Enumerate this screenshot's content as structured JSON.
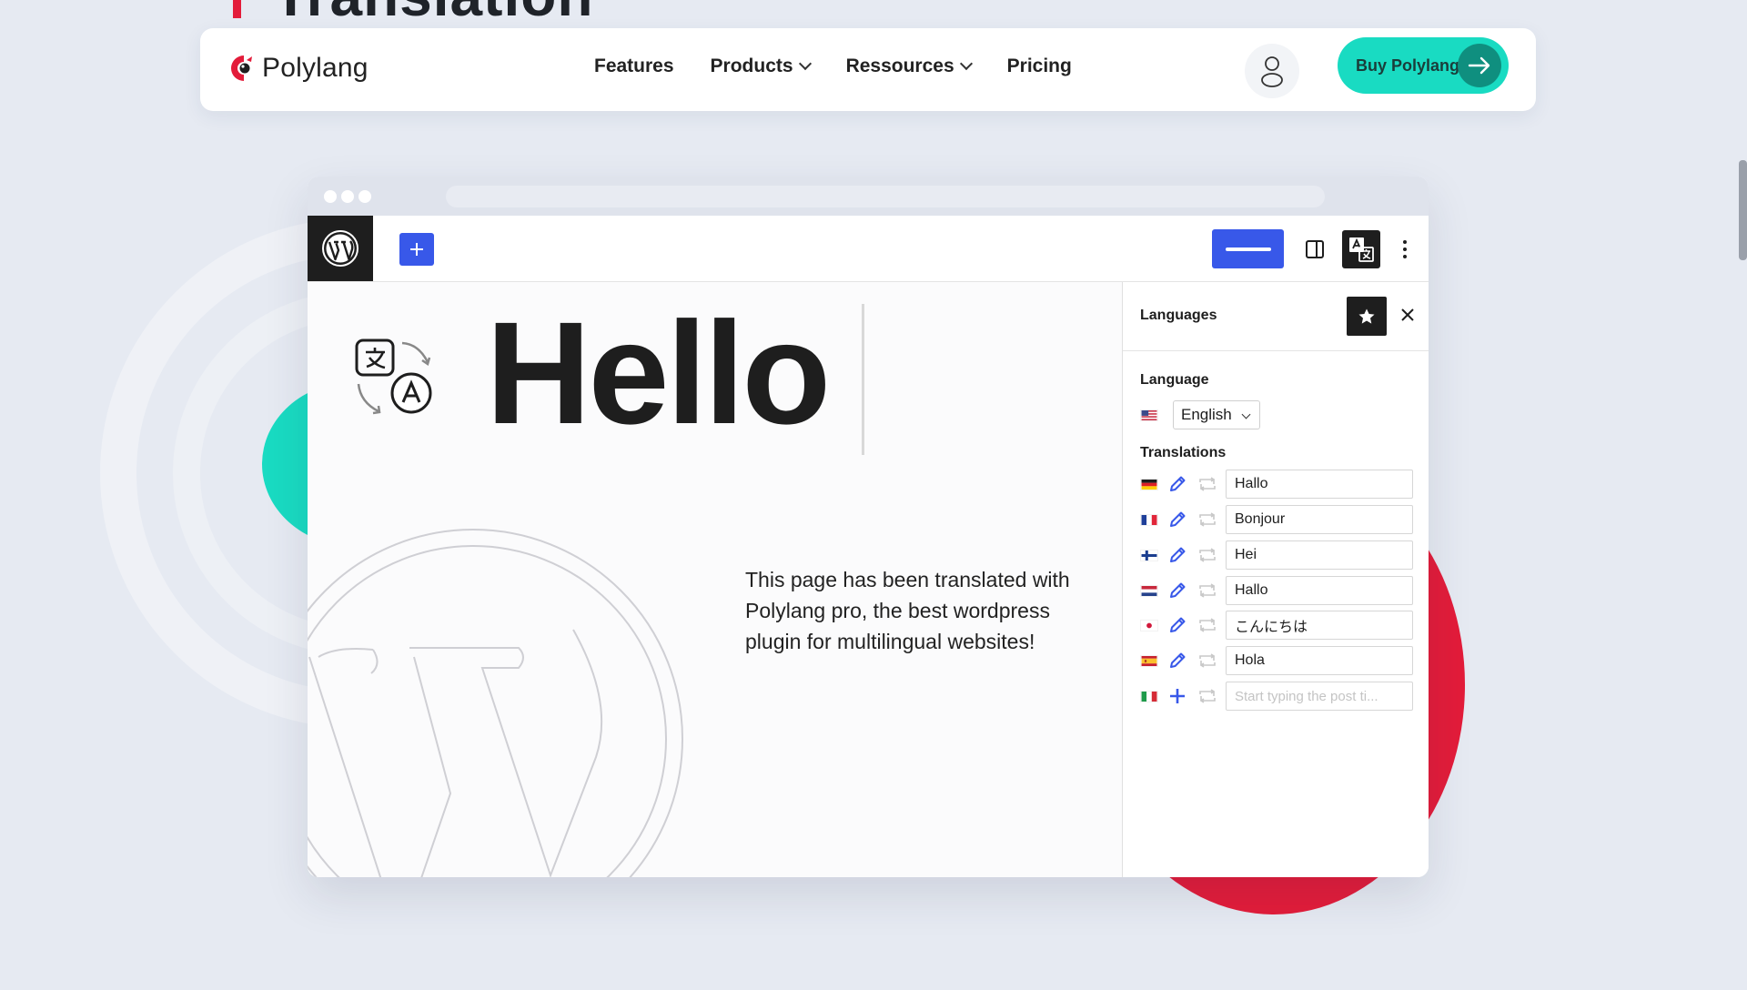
{
  "page": {
    "heading": "Translation"
  },
  "navbar": {
    "logo_text": "Polylang",
    "links": [
      {
        "label": "Features",
        "has_dropdown": false
      },
      {
        "label": "Products",
        "has_dropdown": true
      },
      {
        "label": "Ressources",
        "has_dropdown": true
      },
      {
        "label": "Pricing",
        "has_dropdown": false
      }
    ],
    "user_icon": "user-icon",
    "buy_label": "Buy Polylang",
    "buy_icon": "arrow-right-icon"
  },
  "editor": {
    "heading": "Hello",
    "body_text": "This page has been translated with Polylang pro, the best wordpress plugin for multilingual websites!"
  },
  "sidebar": {
    "title": "Languages",
    "language_label": "Language",
    "selected_language": "English",
    "translations_label": "Translations",
    "translations": [
      {
        "flag": "de",
        "action": "edit",
        "value": "Hallo"
      },
      {
        "flag": "fr",
        "action": "edit",
        "value": "Bonjour"
      },
      {
        "flag": "fi",
        "action": "edit",
        "value": "Hei"
      },
      {
        "flag": "nl",
        "action": "edit",
        "value": "Hallo"
      },
      {
        "flag": "jp",
        "action": "edit",
        "value": "こんにちは"
      },
      {
        "flag": "es",
        "action": "edit",
        "value": "Hola"
      },
      {
        "flag": "it",
        "action": "add",
        "value": "",
        "placeholder": "Start typing the post ti..."
      }
    ]
  },
  "colors": {
    "accent_teal": "#19dbc2",
    "accent_red": "#e31c3a",
    "wp_blue": "#3858e9",
    "dark": "#1e1e1e"
  }
}
